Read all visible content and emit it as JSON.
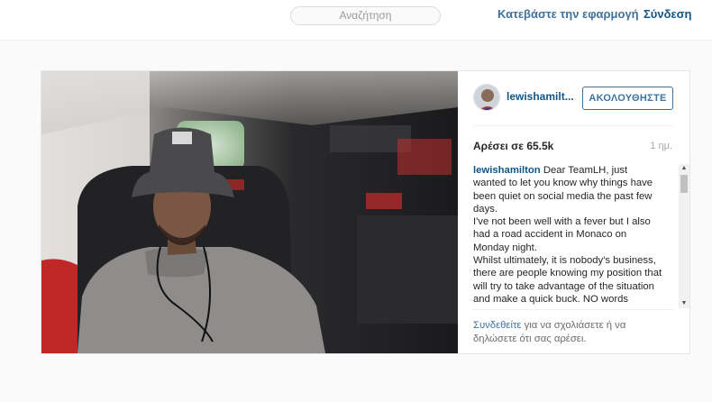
{
  "header": {
    "search_placeholder": "Αναζήτηση",
    "get_app": "Κατεβάστε την εφαρμογή",
    "login": "Σύνδεση"
  },
  "post": {
    "username": "lewishamilt...",
    "follow_label": "ΑΚΟΛΟΥΘΗΣΤΕ",
    "likes": "Αρέσει σε 65.5k",
    "time": "1 ημ.",
    "caption_user": "lewishamilton",
    "caption_text": " Dear TeamLH, just wanted to let you know why things have been quiet on social media the past few days.\nI've not been well with a fever but I also had a road accident in Monaco on Monday night.\nWhilst ultimately, it is nobody's business, there are people knowing my position that will try to take advantage of the situation and make a quick buck. NO words",
    "login_link": "Συνδεθείτε",
    "login_rest": " για να σχολιάσετε ή να δηλώσετε ότι σας αρέσει."
  },
  "colors": {
    "link": "#3f729b",
    "username": "#125688",
    "page_bg": "#fafafa"
  },
  "icons": {
    "scroll_up": "scroll-up-arrow-icon",
    "scroll_down": "scroll-down-arrow-icon"
  }
}
